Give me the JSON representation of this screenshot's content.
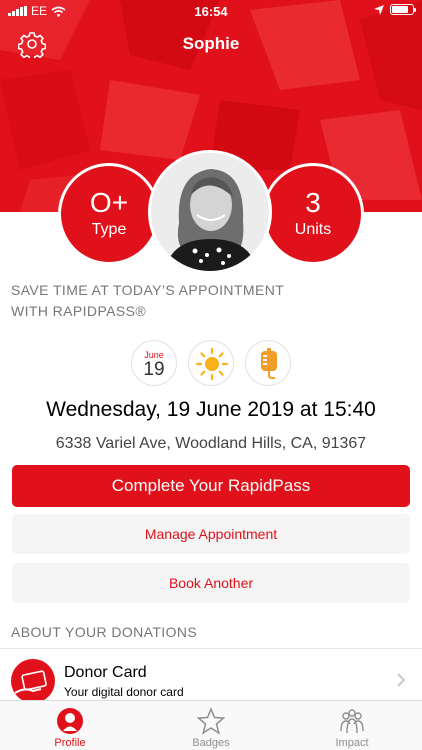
{
  "status_bar": {
    "carrier": "EE",
    "time": "16:54",
    "battery_level": 0.8
  },
  "header": {
    "title": "Sophie"
  },
  "profile": {
    "blood_type": {
      "value": "O+",
      "label": "Type"
    },
    "units": {
      "value": "3",
      "label": "Units"
    }
  },
  "rapidpass": {
    "heading_line1": "SAVE TIME AT TODAY’S APPOINTMENT",
    "heading_line2": "WITH RAPIDPASS®"
  },
  "appointment": {
    "date_icon": {
      "month": "June",
      "day": "19"
    },
    "weather_icon": "sun-icon",
    "donation_icon": "blood-bag-icon",
    "datetime": "Wednesday, 19 June 2019 at 15:40",
    "address": "6338 Variel Ave, Woodland Hills, CA, 91367"
  },
  "buttons": {
    "complete_rapidpass": "Complete Your RapidPass",
    "manage_appointment": "Manage Appointment",
    "book_another": "Book Another"
  },
  "donations": {
    "heading": "ABOUT YOUR DONATIONS",
    "donor_card": {
      "title": "Donor Card",
      "subtitle": "Your digital donor card",
      "icon": "donor-card-icon"
    }
  },
  "tabbar": {
    "tabs": [
      {
        "label": "Profile",
        "icon": "profile-icon",
        "active": true
      },
      {
        "label": "Badges",
        "icon": "star-icon",
        "active": false
      },
      {
        "label": "Impact",
        "icon": "impact-icon",
        "active": false
      }
    ]
  },
  "colors": {
    "brand": "#e0111a",
    "muted_text": "#777777",
    "button_bg": "#f5f5f5"
  }
}
